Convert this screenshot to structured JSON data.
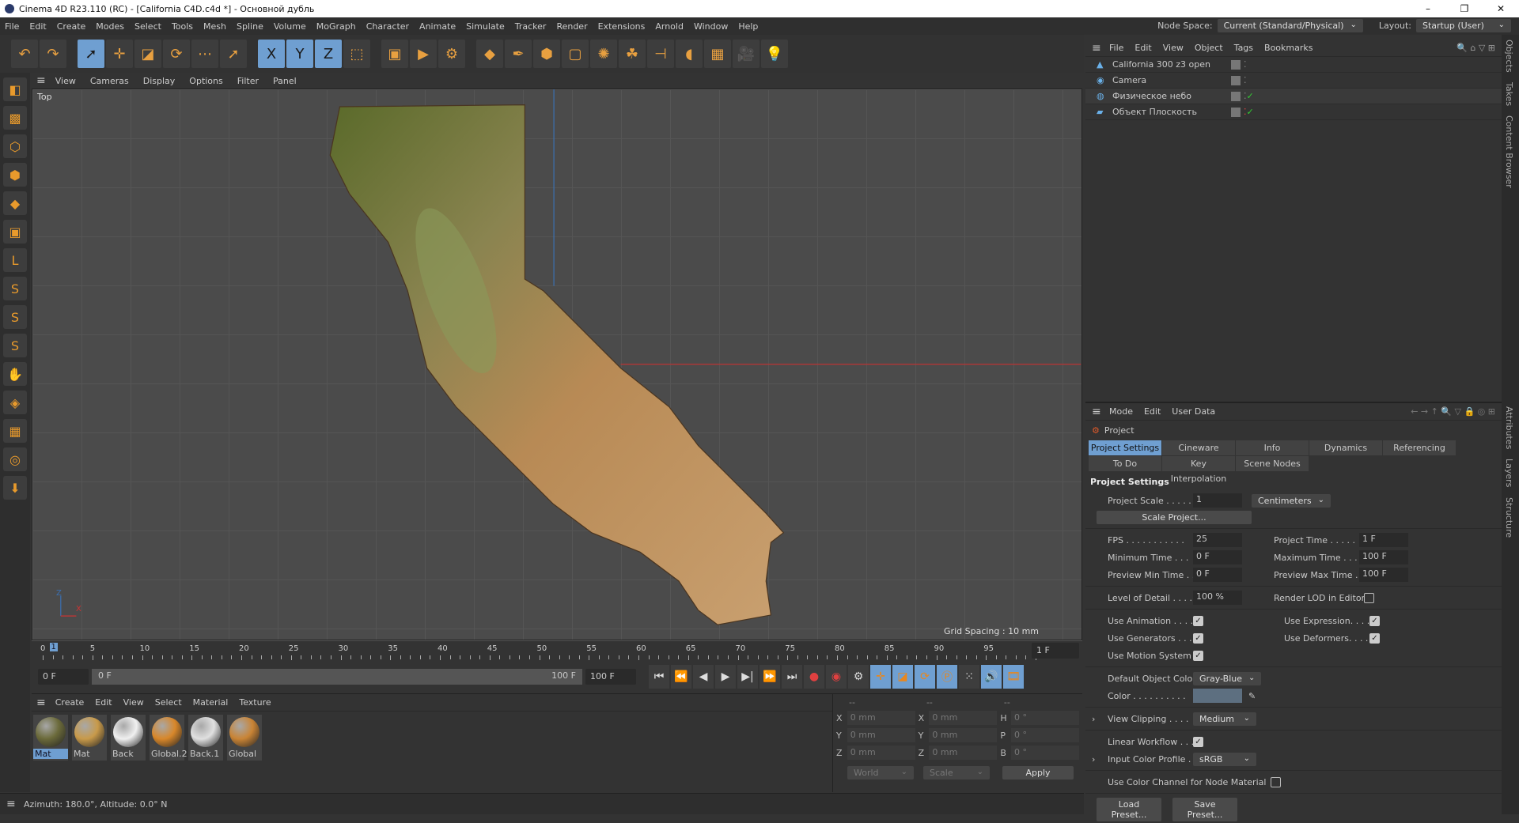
{
  "window": {
    "title": "Cinema 4D R23.110 (RC) - [California C4D.c4d *] - Основной дубль",
    "controls": [
      "–",
      "❐",
      "✕"
    ]
  },
  "menubar": {
    "items": [
      "File",
      "Edit",
      "Create",
      "Modes",
      "Select",
      "Tools",
      "Mesh",
      "Spline",
      "Volume",
      "MoGraph",
      "Character",
      "Animate",
      "Simulate",
      "Tracker",
      "Render",
      "Extensions",
      "Arnold",
      "Window",
      "Help"
    ],
    "node_space_label": "Node Space:",
    "node_space_value": "Current (Standard/Physical)",
    "layout_label": "Layout:",
    "layout_value": "Startup (User)"
  },
  "toolbar": {
    "icons": [
      {
        "name": "undo-icon",
        "g": "↶"
      },
      {
        "name": "redo-icon",
        "g": "↷"
      },
      {
        "sep": true
      },
      {
        "name": "select-icon",
        "g": "➚",
        "sel": true
      },
      {
        "name": "move-icon",
        "g": "✛"
      },
      {
        "name": "scale-icon",
        "g": "◪"
      },
      {
        "name": "rotate-icon",
        "g": "⟳"
      },
      {
        "name": "recent-tools-icon",
        "g": "⋯"
      },
      {
        "name": "live-select-icon",
        "g": "➚"
      },
      {
        "sep": true
      },
      {
        "name": "x-axis-icon",
        "g": "X",
        "sel": true
      },
      {
        "name": "y-axis-icon",
        "g": "Y",
        "sel": true
      },
      {
        "name": "z-axis-icon",
        "g": "Z",
        "sel": true
      },
      {
        "name": "coordinate-system-icon",
        "g": "⬚"
      },
      {
        "sep": true
      },
      {
        "name": "render-view-icon",
        "g": "▣"
      },
      {
        "name": "render-picture-viewer-icon",
        "g": "▶"
      },
      {
        "name": "render-settings-icon",
        "g": "⚙"
      },
      {
        "sep": true
      },
      {
        "name": "cube-icon",
        "g": "◆"
      },
      {
        "name": "pen-icon",
        "g": "✒"
      },
      {
        "name": "subdivision-icon",
        "g": "⬢"
      },
      {
        "name": "extrude-icon",
        "g": "▢"
      },
      {
        "name": "array-icon",
        "g": "✺"
      },
      {
        "name": "cloner-icon",
        "g": "☘"
      },
      {
        "name": "deformer-icon",
        "g": "⊣"
      },
      {
        "name": "field-icon",
        "g": "◖"
      },
      {
        "name": "floor-icon",
        "g": "▦"
      },
      {
        "name": "camera-icon",
        "g": "🎥"
      },
      {
        "name": "light-icon",
        "g": "💡"
      }
    ]
  },
  "left_tools": [
    "cube-mode-icon",
    "texture-mode-icon",
    "points-mode-icon",
    "edges-mode-icon",
    "polygons-mode-icon",
    "model-mode-icon",
    "axis-icon",
    "snap-icon",
    "snap-settings-icon",
    "workplane-icon",
    "magnet-icon",
    "floor-grid-icon",
    "grid-icon",
    "locked-workplane-icon",
    "solo-icon"
  ],
  "viewport": {
    "menu": [
      "View",
      "Cameras",
      "Display",
      "Options",
      "Filter",
      "Panel"
    ],
    "label": "Top",
    "grid_spacing": "Grid Spacing : 10 mm",
    "axis_z": "Z",
    "axis_x": "X"
  },
  "timeline": {
    "ticks": [
      "0",
      "5",
      "10",
      "15",
      "20",
      "25",
      "30",
      "35",
      "40",
      "45",
      "50",
      "55",
      "60",
      "65",
      "70",
      "75",
      "80",
      "85",
      "90",
      "95",
      "100"
    ],
    "current": "1",
    "current_frame_field": "1 F",
    "start_field": "0 F",
    "range_start": "0 F",
    "range_end": "100 F",
    "end_field": "100 F"
  },
  "transport": [
    {
      "name": "go-to-start-icon",
      "g": "⏮"
    },
    {
      "name": "previous-key-icon",
      "g": "⏪"
    },
    {
      "name": "previous-frame-icon",
      "g": "◀"
    },
    {
      "name": "play-icon",
      "g": "▶"
    },
    {
      "name": "next-frame-icon",
      "g": "▶|"
    },
    {
      "name": "next-key-icon",
      "g": "⏩"
    },
    {
      "name": "go-to-end-icon",
      "g": "⏭"
    },
    {
      "name": "record-icon",
      "g": "●"
    },
    {
      "name": "autokey-icon",
      "g": "◉"
    },
    {
      "name": "keyframe-selection-icon",
      "g": "⚙"
    },
    {
      "name": "key-position-icon",
      "g": "✛",
      "sel": true
    },
    {
      "name": "key-scale-icon",
      "g": "◪",
      "sel": true
    },
    {
      "name": "key-rotation-icon",
      "g": "⟳",
      "sel": true
    },
    {
      "name": "key-parameter-icon",
      "g": "Ⓟ",
      "sel": true
    },
    {
      "name": "key-pla-icon",
      "g": "⁙"
    },
    {
      "name": "sound-icon",
      "g": "🔊",
      "sel": true
    },
    {
      "name": "film-icon",
      "g": "🎞",
      "sel": true
    }
  ],
  "materials": {
    "menu": [
      "Create",
      "Edit",
      "View",
      "Select",
      "Material",
      "Texture"
    ],
    "items": [
      {
        "label": "Mat",
        "color": "#6b6a3a",
        "selected": true
      },
      {
        "label": "Mat",
        "color": "#c89a4a"
      },
      {
        "label": "Back",
        "color": "#f0f0f0"
      },
      {
        "label": "Global.2",
        "color": "#d8872a"
      },
      {
        "label": "Back.1",
        "color": "#e0e0e0"
      },
      {
        "label": "Global",
        "color": "#c98435"
      }
    ]
  },
  "coordinates": {
    "headers": [
      "--",
      "--",
      "--"
    ],
    "rows": [
      [
        "X",
        "0 mm",
        "X",
        "0 mm",
        "H",
        "0 °"
      ],
      [
        "Y",
        "0 mm",
        "Y",
        "0 mm",
        "P",
        "0 °"
      ],
      [
        "Z",
        "0 mm",
        "Z",
        "0 mm",
        "B",
        "0 °"
      ]
    ],
    "mode": "World",
    "size_mode": "Scale",
    "apply": "Apply"
  },
  "status": "Azimuth: 180.0°, Altitude: 0.0°  N",
  "objects": {
    "menu": [
      "File",
      "Edit",
      "View",
      "Object",
      "Tags",
      "Bookmarks"
    ],
    "items": [
      {
        "name": "California 300 z3 open",
        "icon": "▲"
      },
      {
        "name": "Camera",
        "icon": "◉"
      },
      {
        "name": "Физическое небо",
        "icon": "◍"
      },
      {
        "name": "Объект Плоскость",
        "icon": "▰"
      }
    ]
  },
  "attributes": {
    "menu": [
      "Mode",
      "Edit",
      "User Data"
    ],
    "title": "Project",
    "tabs": [
      "Project Settings",
      "Cineware",
      "Info",
      "Dynamics",
      "Referencing",
      "To Do",
      "Key Interpolation",
      "Scene Nodes"
    ],
    "section": "Project Settings",
    "project_scale_label": "Project Scale . . . . .",
    "project_scale": "1",
    "units": "Centimeters",
    "scale_project": "Scale Project...",
    "fps_label": "FPS . . . . . . . . . . .",
    "fps": "25",
    "project_time_label": "Project Time . . . . .",
    "project_time": "1 F",
    "min_time_label": "Minimum Time . . .",
    "min_time": "0 F",
    "max_time_label": "Maximum Time . . .",
    "max_time": "100 F",
    "prev_min_label": "Preview Min Time . .",
    "prev_min": "0 F",
    "prev_max_label": "Preview Max Time .",
    "prev_max": "100 F",
    "lod_label": "Level of Detail . . . .",
    "lod": "100 %",
    "render_lod_label": "Render LOD in Editor",
    "use_animation": "Use Animation . . . .",
    "use_expression": "Use Expression. . . .",
    "use_generators": "Use Generators . . .",
    "use_deformers": "Use Deformers. . . .",
    "use_motion": "Use Motion System",
    "default_color_label": "Default Object Color",
    "default_color": "Gray-Blue",
    "color_label": "Color . . . . . . . . . .",
    "color_value": "#5d6f80",
    "view_clipping_label": "View Clipping . . . .",
    "view_clipping": "Medium",
    "linear_workflow": "Linear Workflow . . .",
    "input_profile_label": "Input Color Profile .",
    "input_profile": "sRGB",
    "node_material": "Use Color Channel for Node Material",
    "load_preset": "Load Preset...",
    "save_preset": "Save Preset..."
  },
  "side_tabs_top": [
    "Objects",
    "Takes",
    "Content Browser"
  ],
  "side_tabs_bottom": [
    "Attributes",
    "Layers",
    "Structure"
  ],
  "colors": {
    "accent": "#6f9fd1",
    "orange": "#e8871e"
  }
}
